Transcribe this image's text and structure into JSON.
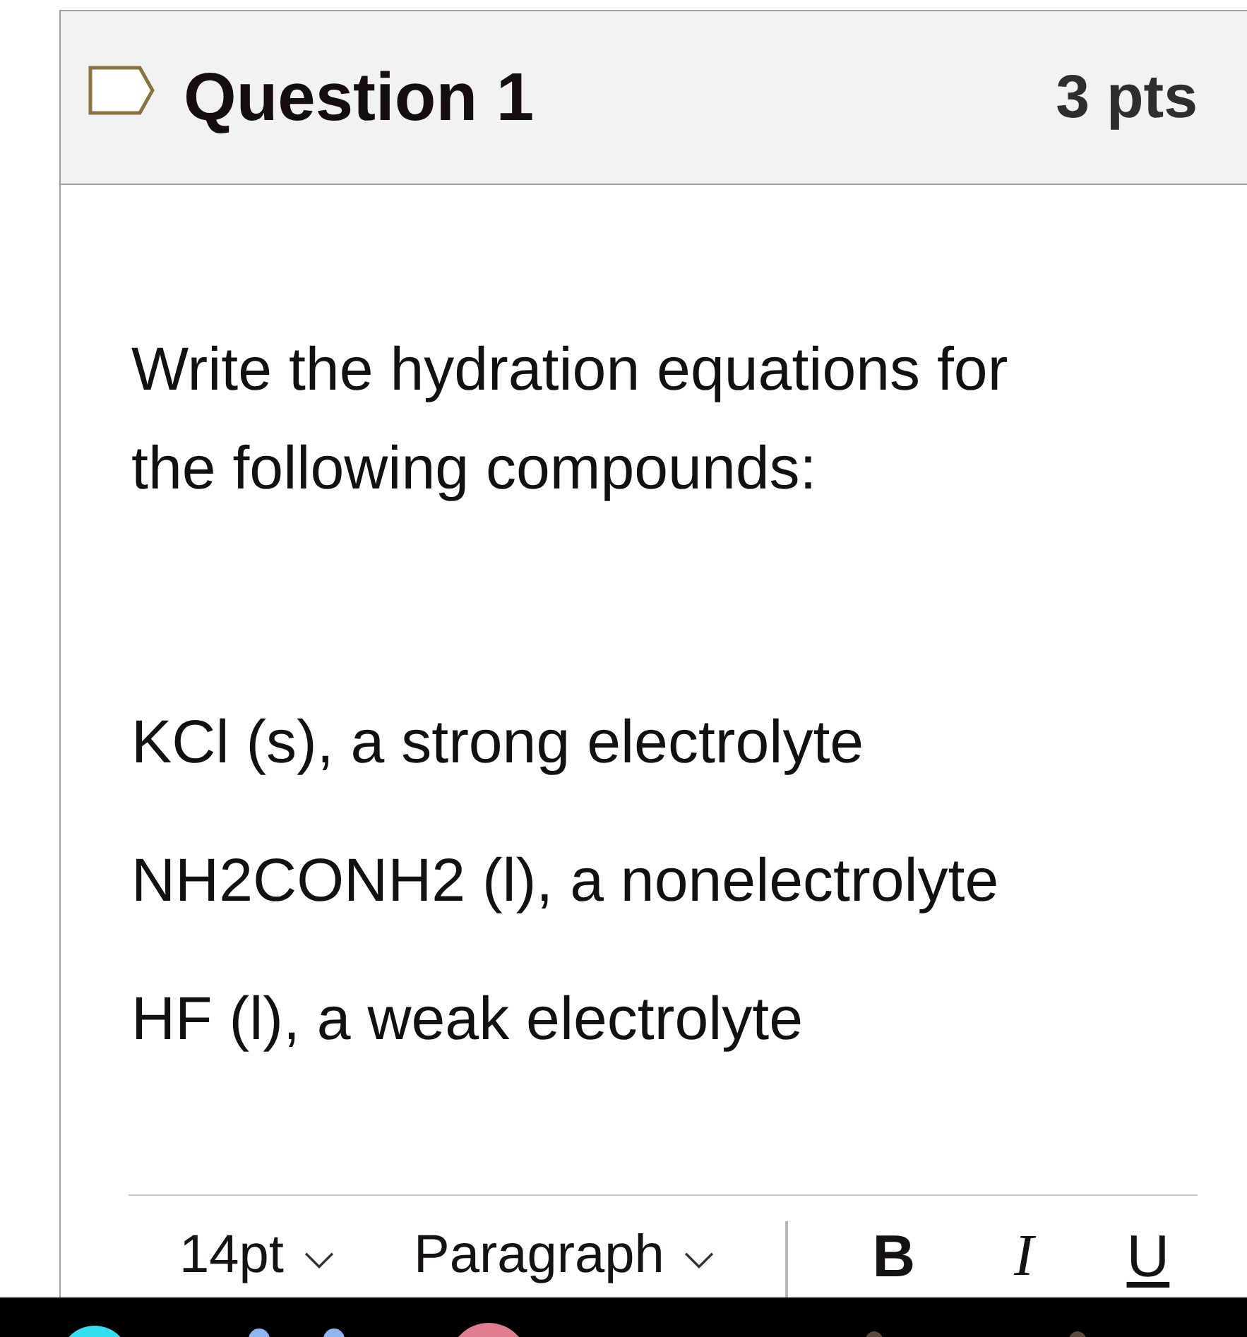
{
  "question": {
    "title": "Question 1",
    "points": "3 pts",
    "flagged": false
  },
  "body": {
    "paragraphs": [
      "Write the hydration equations for the following compounds:",
      "KCl (s), a strong electrolyte",
      "NH2CONH2 (l), a nonelectrolyte",
      "HF (l), a weak electrolyte"
    ]
  },
  "editor_toolbar": {
    "font_size": "14pt",
    "block_format": "Paragraph",
    "buttons": [
      {
        "kind": "bold",
        "label": "B"
      },
      {
        "kind": "italic",
        "label": "I"
      },
      {
        "kind": "underline",
        "label": "U"
      }
    ]
  }
}
